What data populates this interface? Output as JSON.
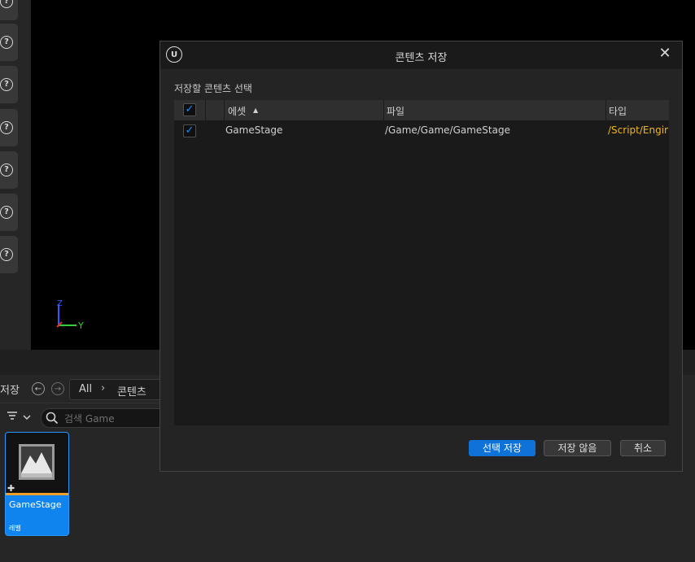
{
  "dialog": {
    "title": "콘텐츠 저장",
    "section_label": "저장할 콘텐츠 선택",
    "columns": {
      "asset": "에셋",
      "asset_sort": "▲",
      "file": "파일",
      "type": "타입"
    },
    "rows": [
      {
        "checked": true,
        "asset": "GameStage",
        "file": "/Game/Game/GameStage",
        "type": "/Script/Engir"
      }
    ],
    "buttons": {
      "save_selected": "선택 저장",
      "dont_save": "저장 않음",
      "cancel": "취소"
    },
    "close_glyph": "✕"
  },
  "content_browser": {
    "title": "저장",
    "breadcrumb": {
      "root": "All",
      "item": "콘텐츠"
    },
    "search": {
      "placeholder": "검색 Game"
    },
    "asset": {
      "name": "GameStage",
      "type": "레벨"
    }
  },
  "viewport": {
    "gizmo_z": "Z",
    "gizmo_y": "Y"
  },
  "colors": {
    "accent": "#0f84ef",
    "type_text": "#f0b51e",
    "checkbox": "#1b8cff"
  },
  "icons": [
    "help-icon",
    "unreal-logo-icon",
    "close-icon",
    "back-icon",
    "forward-icon",
    "chevron-right-icon",
    "filter-icon",
    "chevron-down-icon",
    "search-icon",
    "level-icon",
    "puzzle-icon",
    "check-icon",
    "sort-ascending-icon"
  ]
}
